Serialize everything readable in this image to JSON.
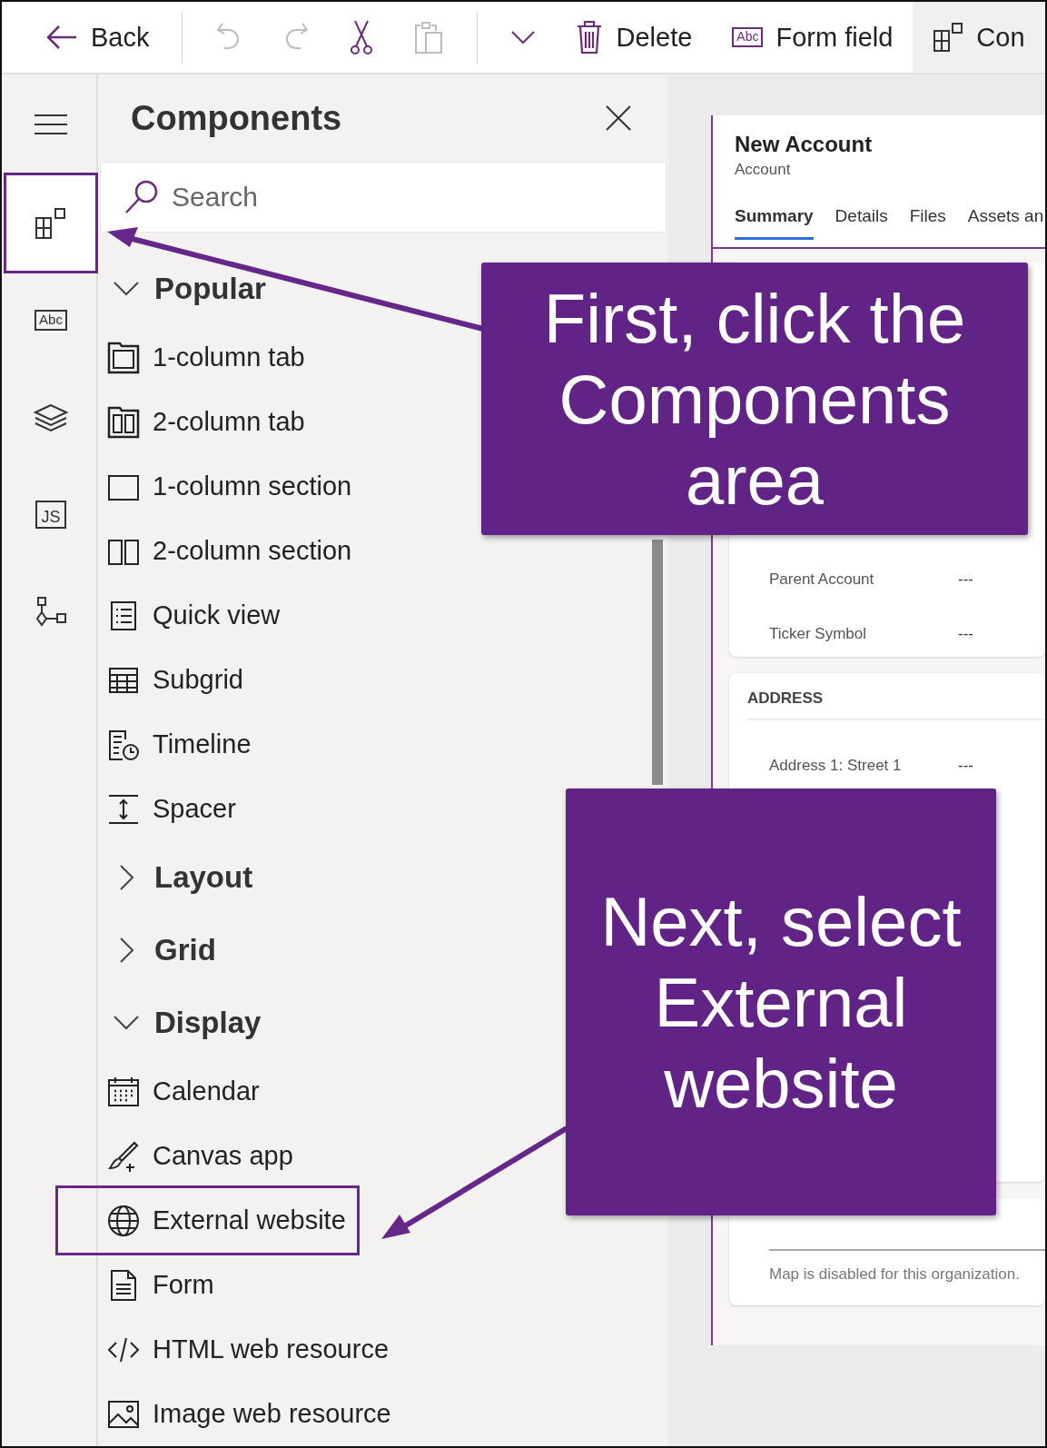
{
  "toolbar": [
    {
      "kind": "back",
      "label": "Back",
      "disabled": false,
      "selected": false
    },
    {
      "kind": "undo",
      "disabled": true,
      "selected": false
    },
    {
      "kind": "redo",
      "disabled": true,
      "selected": false
    },
    {
      "kind": "cut",
      "disabled": false,
      "selected": false
    },
    {
      "kind": "paste",
      "disabled": true,
      "selected": false
    },
    {
      "kind": "more",
      "disabled": false,
      "selected": false
    },
    {
      "kind": "delete",
      "label": "Delete",
      "disabled": false,
      "selected": false
    },
    {
      "kind": "field",
      "label": "Form field",
      "icon_text": "Abc",
      "disabled": false,
      "selected": false
    },
    {
      "kind": "components",
      "label": "Con",
      "disabled": false,
      "selected": true
    }
  ],
  "rail": [
    {
      "kind": "menu",
      "selected": false,
      "highlighted": false
    },
    {
      "kind": "components",
      "selected": true,
      "highlighted": true
    },
    {
      "kind": "field",
      "icon_text": "Abc",
      "selected": false,
      "highlighted": false
    },
    {
      "kind": "layers",
      "selected": false,
      "highlighted": false
    },
    {
      "kind": "script",
      "icon_text": "JS",
      "selected": false,
      "highlighted": false
    },
    {
      "kind": "tree",
      "selected": false,
      "highlighted": false
    }
  ],
  "panel": {
    "title": "Components",
    "search": {
      "placeholder": "Search"
    },
    "groups": [
      {
        "label": "Popular",
        "expanded": true,
        "items": [
          {
            "kind": "tab1",
            "label": "1-column tab",
            "highlighted": false
          },
          {
            "kind": "tab2",
            "label": "2-column tab",
            "highlighted": false
          },
          {
            "kind": "sec1",
            "label": "1-column section",
            "highlighted": false
          },
          {
            "kind": "sec2",
            "label": "2-column section",
            "highlighted": false
          },
          {
            "kind": "quickview",
            "label": "Quick view",
            "highlighted": false
          },
          {
            "kind": "subgrid",
            "label": "Subgrid",
            "highlighted": false
          },
          {
            "kind": "timeline",
            "label": "Timeline",
            "highlighted": false
          },
          {
            "kind": "spacer",
            "label": "Spacer",
            "highlighted": false
          }
        ]
      },
      {
        "label": "Layout",
        "expanded": false
      },
      {
        "label": "Grid",
        "expanded": false
      },
      {
        "label": "Display",
        "expanded": true,
        "items": [
          {
            "kind": "calendar",
            "label": "Calendar",
            "highlighted": false
          },
          {
            "kind": "canvas",
            "label": "Canvas app",
            "highlighted": false
          },
          {
            "kind": "globe",
            "label": "External website",
            "highlighted": true
          },
          {
            "kind": "form",
            "label": "Form",
            "highlighted": false
          },
          {
            "kind": "code",
            "label": "HTML web resource",
            "highlighted": false
          },
          {
            "kind": "image",
            "label": "Image web resource",
            "highlighted": false
          }
        ]
      }
    ]
  },
  "form": {
    "title": "New Account",
    "subtitle": "Account",
    "tabs": [
      {
        "label": "Summary",
        "selected": true
      },
      {
        "label": "Details",
        "selected": false
      },
      {
        "label": "Files",
        "selected": false
      },
      {
        "label": "Assets an",
        "selected": false
      }
    ],
    "sections": [
      {
        "kind": "fields",
        "fields": [
          {
            "label": "Parent Account",
            "value": "---"
          },
          {
            "label": "Ticker Symbol",
            "value": "---"
          }
        ]
      },
      {
        "kind": "fields",
        "heading": "ADDRESS",
        "fields": [
          {
            "label": "Address 1: Street 1",
            "value": "---"
          }
        ]
      },
      {
        "kind": "map",
        "message": "Map is disabled for this organization."
      }
    ]
  },
  "callouts": [
    {
      "lines": [
        "First, click the",
        "Components",
        "area"
      ]
    },
    {
      "lines": [
        "Next, select",
        "External",
        "website"
      ]
    }
  ]
}
